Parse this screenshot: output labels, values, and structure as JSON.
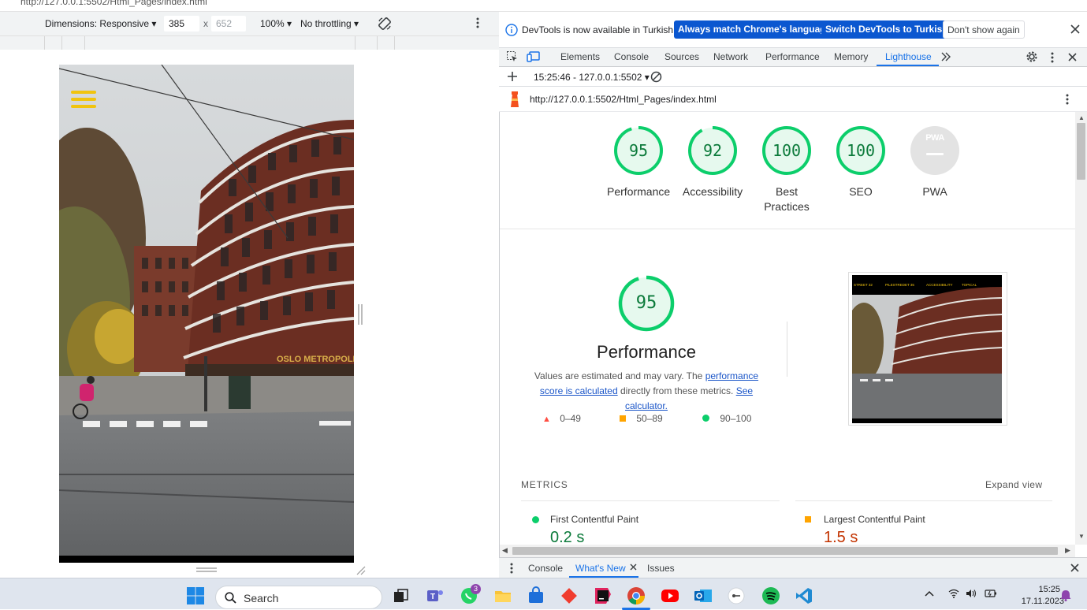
{
  "browser": {
    "url_fragment": "http://127.0.0.1:5502/Html_Pages/index.html"
  },
  "device_toolbar": {
    "dimensions_label": "Dimensions: Responsive",
    "width_value": "385",
    "times": "x",
    "height_value": "652",
    "zoom": "100%",
    "throttling": "No throttling"
  },
  "device_page": {
    "building_sign": "OSLO METROPOLIT",
    "screenshot_nav": [
      "STREET 32",
      "PILESTREDET 35",
      "ACCESSIBILITY",
      "TOPICAL"
    ]
  },
  "infobar": {
    "message": "DevTools is now available in Turkish!",
    "btn_match": "Always match Chrome's language",
    "btn_switch": "Switch DevTools to Turkish",
    "btn_dismiss": "Don't show again"
  },
  "tabs": {
    "elements": "Elements",
    "console": "Console",
    "sources": "Sources",
    "network": "Network",
    "performance": "Performance",
    "memory": "Memory",
    "lighthouse": "Lighthouse"
  },
  "lighthouse": {
    "report_selector": "15:25:46 - 127.0.0.1:5502",
    "url": "http://127.0.0.1:5502/Html_Pages/index.html",
    "gauges": [
      {
        "score": "95",
        "label": "Performance"
      },
      {
        "score": "92",
        "label": "Accessibility"
      },
      {
        "score": "100",
        "label": "Best Practices"
      },
      {
        "score": "100",
        "label": "SEO"
      },
      {
        "score": "",
        "label": "PWA",
        "badge": "PWA"
      }
    ],
    "main_score": "95",
    "main_label": "Performance",
    "desc_pre": "Values are estimated and may vary. The",
    "desc_link1": "performance score is calculated",
    "desc_mid": "directly from these metrics.",
    "desc_link2": "See calculator.",
    "legend": {
      "low": "0–49",
      "mid": "50–89",
      "high": "90–100"
    },
    "metrics_title": "METRICS",
    "expand_view": "Expand view",
    "metrics": [
      {
        "name": "First Contentful Paint",
        "value": "0.2 s",
        "status": "pass"
      },
      {
        "name": "Largest Contentful Paint",
        "value": "1.5 s",
        "status": "average"
      }
    ]
  },
  "drawer": {
    "console": "Console",
    "whats_new": "What's New",
    "issues": "Issues"
  },
  "taskbar": {
    "search_placeholder": "Search",
    "teams_badge": "3",
    "time": "15:25",
    "date": "17.11.2023"
  },
  "colors": {
    "pass": "#0cce6b",
    "pass_text": "#0b7a3a",
    "average": "#ffa400",
    "average_text": "#c33300",
    "fail": "#ff4e42",
    "accent": "#1a73e8"
  }
}
